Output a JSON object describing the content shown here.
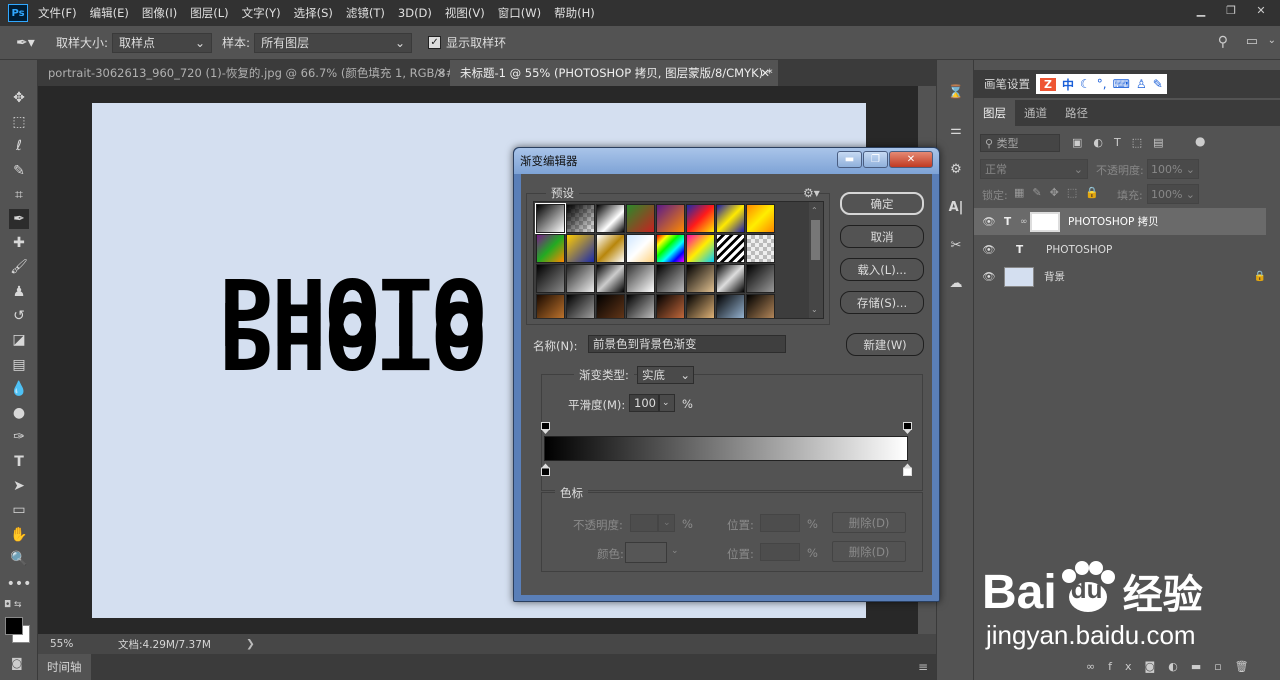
{
  "app": {
    "logo": "Ps"
  },
  "menu": [
    "文件(F)",
    "编辑(E)",
    "图像(I)",
    "图层(L)",
    "文字(Y)",
    "选择(S)",
    "滤镜(T)",
    "3D(D)",
    "视图(V)",
    "窗口(W)",
    "帮助(H)"
  ],
  "options": {
    "sample_size_label": "取样大小:",
    "sample_size_value": "取样点",
    "sample_label": "样本:",
    "sample_value": "所有图层",
    "show_ring_label": "显示取样环"
  },
  "tabs": [
    {
      "label": "portrait-3062613_960_720 (1)-恢复的.jpg @ 66.7% (颜色填充 1, RGB/8#) *"
    },
    {
      "label": "未标题-1 @ 55% (PHOTOSHOP 拷贝, 图层蒙版/8/CMYK) *"
    }
  ],
  "canvas": {
    "text_top": "PHOTO",
    "text_bottom": "PHOTO",
    "bg_color": "#d4dff0"
  },
  "status": {
    "zoom": "55%",
    "doc": "文档:4.29M/7.37M",
    "arrow": "❯"
  },
  "timeline": {
    "label": "时间轴"
  },
  "brush_bar": {
    "label": "画笔设置",
    "ime_text": "中"
  },
  "layers_panel": {
    "tabs": [
      "图层",
      "通道",
      "路径"
    ],
    "filter_label": "类型",
    "blend_mode": "正常",
    "opacity_label": "不透明度:",
    "opacity_value": "100%",
    "lock_label": "锁定:",
    "fill_label": "填充:",
    "fill_value": "100%",
    "layers": [
      {
        "name": "PHOTOSHOP 拷贝",
        "type": "T"
      },
      {
        "name": "PHOTOSHOP",
        "type": "T"
      },
      {
        "name": "背景",
        "type": "image"
      }
    ]
  },
  "dialog": {
    "title": "渐变编辑器",
    "presets_label": "预设",
    "buttons": {
      "ok": "确定",
      "cancel": "取消",
      "load": "载入(L)...",
      "save": "存储(S)...",
      "new": "新建(W)",
      "delete": "删除(D)"
    },
    "name_label": "名称(N):",
    "name_value": "前景色到背景色渐变",
    "type_label": "渐变类型:",
    "type_value": "实底",
    "smooth_label": "平滑度(M):",
    "smooth_value": "100",
    "percent": "%",
    "stops_legend": "色标",
    "opacity_label": "不透明度:",
    "color_label": "颜色:",
    "position_label": "位置:"
  },
  "watermark": {
    "brand": "Bai",
    "brand2": "du",
    "cn": "经验",
    "url": "jingyan.baidu.com"
  }
}
